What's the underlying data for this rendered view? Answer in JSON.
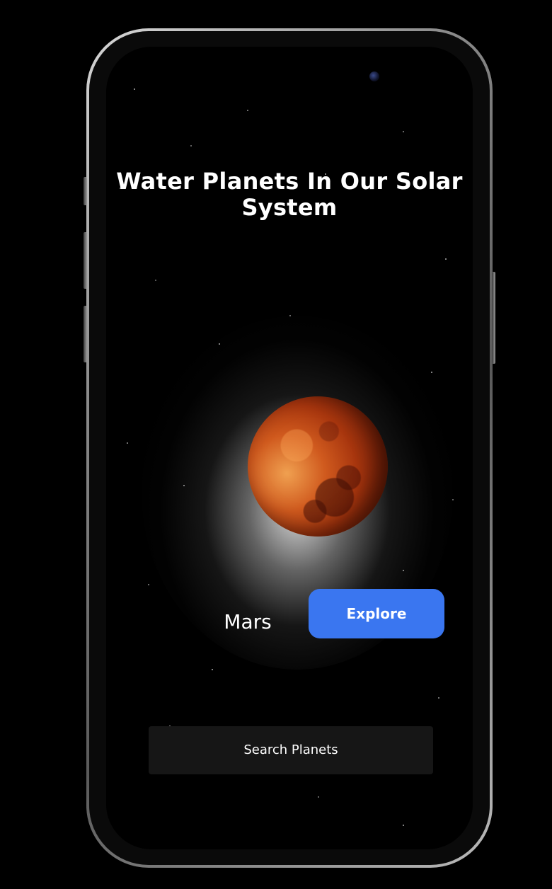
{
  "screen": {
    "title": "Water Planets In Our Solar System",
    "planet": {
      "name": "Mars",
      "image": "mars-planet"
    },
    "explore_button": {
      "label": "Explore",
      "color": "#3a76f0"
    },
    "search_bar": {
      "label": "Search Planets"
    }
  },
  "device": {
    "type": "smartphone",
    "frame_color": "#9a9a9a",
    "screen_background": "#000000"
  }
}
